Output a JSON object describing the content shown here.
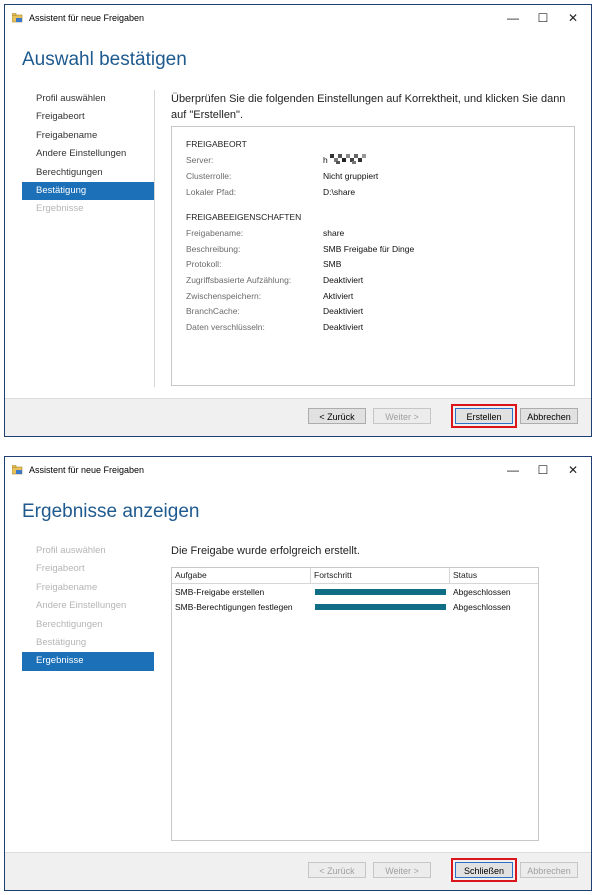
{
  "dialogs": [
    {
      "title": "Assistent für neue Freigaben",
      "header": "Auswahl bestätigen",
      "nav": [
        {
          "label": "Profil auswählen",
          "state": "normal"
        },
        {
          "label": "Freigabeort",
          "state": "normal"
        },
        {
          "label": "Freigabename",
          "state": "normal"
        },
        {
          "label": "Andere Einstellungen",
          "state": "normal"
        },
        {
          "label": "Berechtigungen",
          "state": "normal"
        },
        {
          "label": "Bestätigung",
          "state": "active"
        },
        {
          "label": "Ergebnisse",
          "state": "disabled"
        }
      ],
      "instruction": "Überprüfen Sie die folgenden Einstellungen auf Korrektheit, und klicken Sie dann auf \"Erstellen\".",
      "sections": [
        {
          "title": "FREIGABEORT",
          "rows": [
            {
              "label": "Server:",
              "value": "h"
            },
            {
              "label": "Clusterrolle:",
              "value": "Nicht gruppiert"
            },
            {
              "label": "Lokaler Pfad:",
              "value": "D:\\share"
            }
          ]
        },
        {
          "title": "FREIGABEEIGENSCHAFTEN",
          "rows": [
            {
              "label": "Freigabename:",
              "value": "share"
            },
            {
              "label": "Beschreibung:",
              "value": "SMB Freigabe für Dinge"
            },
            {
              "label": "Protokoll:",
              "value": "SMB"
            },
            {
              "label": "Zugriffsbasierte Aufzählung:",
              "value": "Deaktiviert"
            },
            {
              "label": "Zwischenspeichern:",
              "value": "Aktiviert"
            },
            {
              "label": "BranchCache:",
              "value": "Deaktiviert"
            },
            {
              "label": "Daten verschlüsseln:",
              "value": "Deaktiviert"
            }
          ]
        }
      ],
      "buttons": {
        "back": "< Zurück",
        "next": "Weiter >",
        "primary": "Erstellen",
        "cancel": "Abbrechen"
      }
    },
    {
      "title": "Assistent für neue Freigaben",
      "header": "Ergebnisse anzeigen",
      "nav": [
        {
          "label": "Profil auswählen",
          "state": "disabled"
        },
        {
          "label": "Freigabeort",
          "state": "disabled"
        },
        {
          "label": "Freigabename",
          "state": "disabled"
        },
        {
          "label": "Andere Einstellungen",
          "state": "disabled"
        },
        {
          "label": "Berechtigungen",
          "state": "disabled"
        },
        {
          "label": "Bestätigung",
          "state": "disabled"
        },
        {
          "label": "Ergebnisse",
          "state": "active"
        }
      ],
      "instruction": "Die Freigabe wurde erfolgreich erstellt.",
      "table": {
        "columns": [
          "Aufgabe",
          "Fortschritt",
          "Status"
        ],
        "rows": [
          {
            "task": "SMB-Freigabe erstellen",
            "progress": 1.0,
            "status": "Abgeschlossen"
          },
          {
            "task": "SMB-Berechtigungen festlegen",
            "progress": 1.0,
            "status": "Abgeschlossen"
          }
        ]
      },
      "buttons": {
        "back": "< Zurück",
        "next": "Weiter >",
        "primary": "Schließen",
        "cancel": "Abbrechen"
      }
    }
  ],
  "colors": {
    "accent": "#1b70b8",
    "highlight": "#d9141b",
    "progress": "#0f6e85"
  },
  "icons": {
    "app": "folder-share-icon",
    "minimize": "minimize-icon",
    "maximize": "maximize-icon",
    "close": "close-icon"
  }
}
